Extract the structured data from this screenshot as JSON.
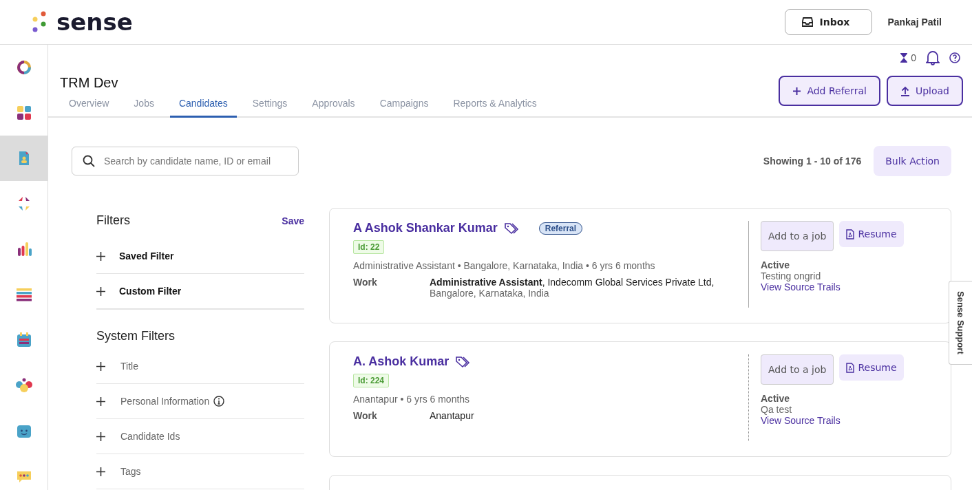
{
  "header": {
    "logo": "sense",
    "inbox_button": "Inbox",
    "user_name": "Pankaj Patil"
  },
  "sidebar": {
    "items": [
      {
        "selected": false
      },
      {
        "selected": false
      },
      {
        "selected": true
      },
      {
        "selected": false
      },
      {
        "selected": false
      },
      {
        "selected": false
      },
      {
        "selected": false
      },
      {
        "selected": false
      },
      {
        "selected": false
      },
      {
        "selected": false
      }
    ]
  },
  "top_counters": {
    "pending_count": "0"
  },
  "page": {
    "title": "TRM Dev"
  },
  "tabs": [
    {
      "label": "Overview",
      "selected": false
    },
    {
      "label": "Jobs",
      "selected": false
    },
    {
      "label": "Candidates",
      "selected": true
    },
    {
      "label": "Settings",
      "selected": false
    },
    {
      "label": "Approvals",
      "selected": false
    },
    {
      "label": "Campaigns",
      "selected": false
    },
    {
      "label": "Reports & Analytics",
      "selected": false
    }
  ],
  "actions": {
    "add_referral": "Add Referral",
    "upload": "Upload"
  },
  "search": {
    "placeholder": "Search by candidate name, ID or email"
  },
  "results": {
    "showing": "Showing 1 - 10 of 176",
    "bulk_action": "Bulk Action"
  },
  "filters": {
    "title": "Filters",
    "save": "Save",
    "groups": [
      {
        "label": "Saved Filter"
      },
      {
        "label": "Custom Filter"
      }
    ],
    "system_title": "System Filters",
    "system": [
      {
        "label": "Title",
        "info": false
      },
      {
        "label": "Personal Information",
        "info": true
      },
      {
        "label": "Candidate Ids",
        "info": false
      },
      {
        "label": "Tags",
        "info": false
      }
    ]
  },
  "candidates": [
    {
      "name": "A Ashok Shankar Kumar",
      "badge": "Referral",
      "id": "Id: 22",
      "summary": "Administrative Assistant • Bangalore, Karnataka, India • 6 yrs 6 months",
      "work_label": "Work",
      "work_detail": "**Administrative Assistant**, Indecomm Global Services Private Ltd,",
      "work_detail_2": "Bangalore, Karnataka, India",
      "add_button": "Add to a job",
      "resume_button": "Resume",
      "status": "Active",
      "note": "Testing ongrid",
      "link": "View Source Trails"
    },
    {
      "name": "A. Ashok Kumar",
      "id": "Id: 224",
      "summary": "Anantapur • 6 yrs 6 months",
      "work_label": "Work",
      "work_detail": "Anantapur",
      "add_button": "Add to a job",
      "resume_button": "Resume",
      "status": "Active",
      "note": "Qa test",
      "link": "View Source Trails"
    }
  ],
  "support_tab": "Sense Support"
}
